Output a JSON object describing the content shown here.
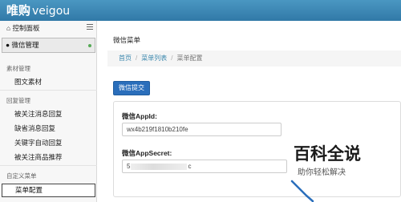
{
  "navbar": {
    "brand_cn": "唯购",
    "brand_en": "veigou"
  },
  "sidebar": {
    "dashboard_label": "控制面板",
    "active_section": "微信管理",
    "groups": [
      {
        "title": "素材管理",
        "items": [
          "图文素材"
        ]
      },
      {
        "title": "回复管理",
        "items": [
          "被关注消息回复",
          "缺省消息回复",
          "关键字自动回复",
          "被关注商品推荐"
        ]
      },
      {
        "title": "自定义菜单",
        "items": [
          "菜单配置"
        ]
      }
    ]
  },
  "main": {
    "title": "微信菜单",
    "breadcrumb": [
      "首页",
      "菜单列表",
      "菜单配置"
    ],
    "submit_label": "微信提交",
    "fields": [
      {
        "label": "微信AppId:",
        "value": "wx4b219f1810b210fe"
      },
      {
        "label": "微信AppSecret:",
        "value_prefix": "5",
        "value_suffix": "c"
      }
    ]
  },
  "watermark": {
    "title": "百科全说",
    "subtitle": "助你轻松解决"
  },
  "colors": {
    "navbar": "#3a87ad",
    "primary_button": "#2a6ebb",
    "link": "#3a87ad"
  }
}
